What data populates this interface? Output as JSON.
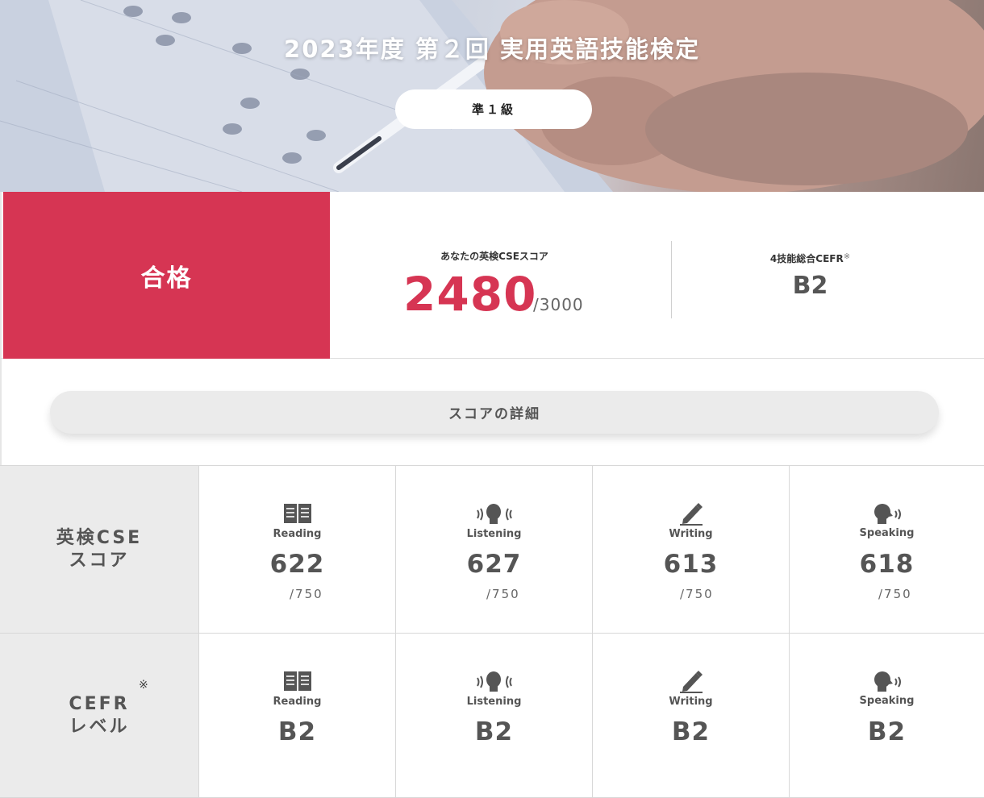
{
  "header": {
    "title": "2023年度 第２回 実用英語技能検定",
    "grade": "準１級"
  },
  "result": {
    "status": "合格",
    "total_label": "あなたの英検CSEスコア",
    "total_score": "2480",
    "total_max": "/3000",
    "cefr_label": "4技能総合CEFR",
    "cefr_note_mark": "※",
    "cefr_value": "B2"
  },
  "details": {
    "button_label": "スコアの詳細"
  },
  "table": {
    "cse_row_label_line1": "英検CSE",
    "cse_row_label_line2": "スコア",
    "cefr_row_label_line1": "CEFR",
    "cefr_row_label_line2": "レベル",
    "cefr_row_note_mark": "※",
    "skills": [
      {
        "name": "Reading",
        "icon": "book-icon",
        "score": "622",
        "max": "/750",
        "cefr": "B2"
      },
      {
        "name": "Listening",
        "icon": "listening-head-icon",
        "score": "627",
        "max": "/750",
        "cefr": "B2"
      },
      {
        "name": "Writing",
        "icon": "pencil-icon",
        "score": "613",
        "max": "/750",
        "cefr": "B2"
      },
      {
        "name": "Speaking",
        "icon": "speaking-head-icon",
        "score": "618",
        "max": "/750",
        "cefr": "B2"
      }
    ]
  },
  "colors": {
    "accent": "#d63553",
    "row_header_bg": "#ebebeb",
    "text": "#555555"
  }
}
